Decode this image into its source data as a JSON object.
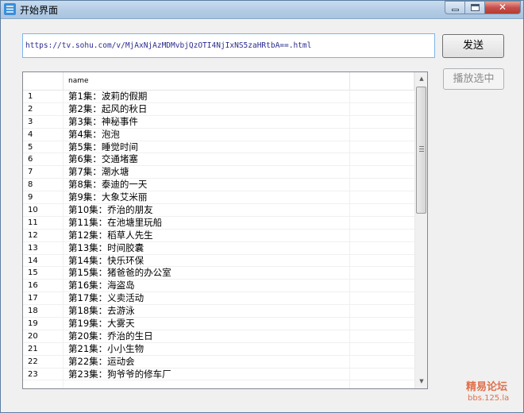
{
  "window": {
    "title": "开始界面"
  },
  "url_input": {
    "value": "https://tv.sohu.com/v/MjAxNjAzMDMvbjQzOTI4NjIxNS5zaHRtbA==.html"
  },
  "buttons": {
    "send": "发送",
    "play_selected": "播放选中"
  },
  "list": {
    "header": {
      "col1": "",
      "col2": "name"
    },
    "rows": [
      {
        "idx": "1",
        "name": "第1集：波莉的假期"
      },
      {
        "idx": "2",
        "name": "第2集：起风的秋日"
      },
      {
        "idx": "3",
        "name": "第3集：神秘事件"
      },
      {
        "idx": "4",
        "name": "第4集：泡泡"
      },
      {
        "idx": "5",
        "name": "第5集：睡觉时间"
      },
      {
        "idx": "6",
        "name": "第6集：交通堵塞"
      },
      {
        "idx": "7",
        "name": "第7集：潮水塘"
      },
      {
        "idx": "8",
        "name": "第8集：泰迪的一天"
      },
      {
        "idx": "9",
        "name": "第9集：大象艾米丽"
      },
      {
        "idx": "10",
        "name": "第10集：乔治的朋友"
      },
      {
        "idx": "11",
        "name": "第11集：在池塘里玩船"
      },
      {
        "idx": "12",
        "name": "第12集：稻草人先生"
      },
      {
        "idx": "13",
        "name": "第13集：时间胶囊"
      },
      {
        "idx": "14",
        "name": "第14集：快乐环保"
      },
      {
        "idx": "15",
        "name": "第15集：猪爸爸的办公室"
      },
      {
        "idx": "16",
        "name": "第16集：海盗岛"
      },
      {
        "idx": "17",
        "name": "第17集：义卖活动"
      },
      {
        "idx": "18",
        "name": "第18集：去游泳"
      },
      {
        "idx": "19",
        "name": "第19集：大雾天"
      },
      {
        "idx": "20",
        "name": "第20集：乔治的生日"
      },
      {
        "idx": "21",
        "name": "第21集：小小生物"
      },
      {
        "idx": "22",
        "name": "第22集：运动会"
      },
      {
        "idx": "23",
        "name": "第23集：狗爷爷的修车厂"
      }
    ]
  },
  "watermark": {
    "line1": "精易论坛",
    "line2": "bbs.125.la"
  },
  "icons": {
    "app": "app-logo-icon",
    "minimize": "minimize-icon",
    "maximize": "maximize-icon",
    "close": "close-icon",
    "scroll_up": "scroll-up-arrow-icon",
    "scroll_down": "scroll-down-arrow-icon"
  }
}
